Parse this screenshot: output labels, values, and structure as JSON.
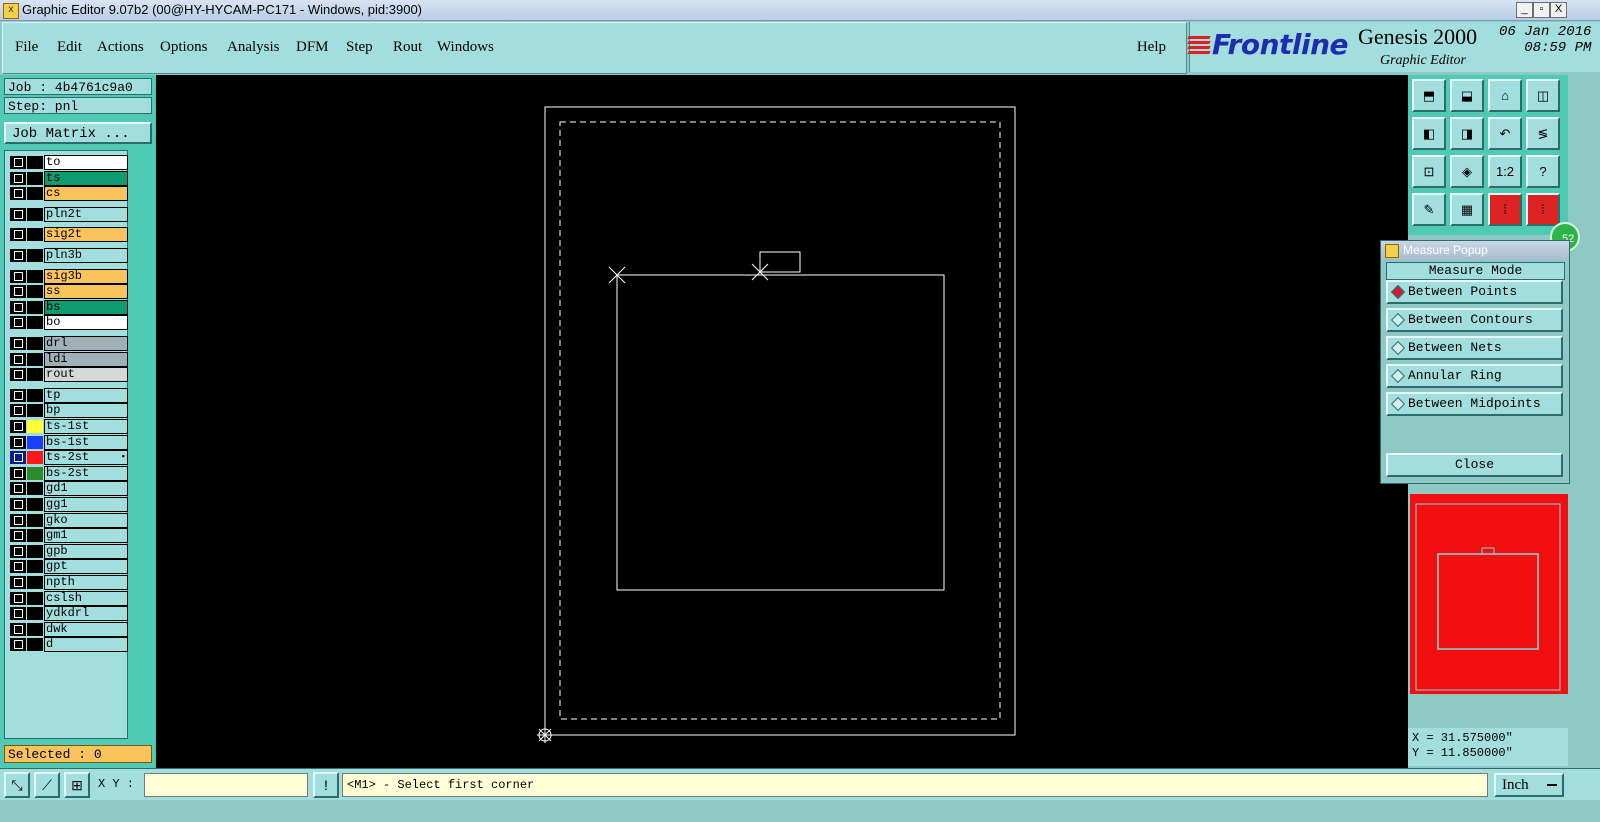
{
  "window": {
    "title": "Graphic Editor 9.07b2 (00@HY-HYCAM-PC171 - Windows, pid:3900)",
    "controls": [
      "_",
      "▫",
      "X"
    ]
  },
  "menu": {
    "items": [
      "File",
      "Edit",
      "Actions",
      "Options",
      "Analysis",
      "DFM",
      "Step",
      "Rout",
      "Windows"
    ],
    "help": "Help"
  },
  "brand": {
    "logo": "Frontline",
    "product": "Genesis 2000",
    "subtitle": "Graphic Editor",
    "date": "06 Jan 2016",
    "time": "08:59 PM"
  },
  "job": {
    "job_label": "Job : 4b4761c9a0",
    "step_label": "Step: pnl",
    "matrix_button": "Job Matrix ..."
  },
  "layers": [
    {
      "name": "to",
      "bg": "#ffffff",
      "swatch": "#000000"
    },
    {
      "name": "ts",
      "bg": "#0e9c6e",
      "swatch": "#000000"
    },
    {
      "name": "cs",
      "bg": "#fbc35b",
      "swatch": "#000000"
    },
    {
      "name": "pln2t",
      "bg": "#a2dedd",
      "swatch": "#000000"
    },
    {
      "name": "sig2t",
      "bg": "#fbc35b",
      "swatch": "#000000"
    },
    {
      "name": "pln3b",
      "bg": "#a2dedd",
      "swatch": "#000000"
    },
    {
      "name": "sig3b",
      "bg": "#fbc35b",
      "swatch": "#000000"
    },
    {
      "name": "ss",
      "bg": "#fbc35b",
      "swatch": "#000000"
    },
    {
      "name": "bs",
      "bg": "#0e9c6e",
      "swatch": "#000000"
    },
    {
      "name": "bo",
      "bg": "#ffffff",
      "swatch": "#000000"
    },
    {
      "name": "drl",
      "bg": "#9fb0b6",
      "swatch": "#000000"
    },
    {
      "name": "ldi",
      "bg": "#9fb0b6",
      "swatch": "#000000"
    },
    {
      "name": "rout",
      "bg": "#d4d8d8",
      "swatch": "#000000"
    },
    {
      "name": "tp",
      "bg": "#a2dedd",
      "swatch": "#000000"
    },
    {
      "name": "bp",
      "bg": "#a2dedd",
      "swatch": "#000000"
    },
    {
      "name": "ts-1st",
      "bg": "#a2dedd",
      "swatch": "#ffff33"
    },
    {
      "name": "bs-1st",
      "bg": "#a2dedd",
      "swatch": "#1a3cff"
    },
    {
      "name": "ts-2st",
      "bg": "#a2dedd",
      "swatch": "#ff1a1a",
      "active": true,
      "mark": "▪"
    },
    {
      "name": "bs-2st",
      "bg": "#a2dedd",
      "swatch": "#2c8a2c"
    },
    {
      "name": "gd1",
      "bg": "#a2dedd",
      "swatch": "#000000"
    },
    {
      "name": "gg1",
      "bg": "#a2dedd",
      "swatch": "#000000"
    },
    {
      "name": "gko",
      "bg": "#a2dedd",
      "swatch": "#000000"
    },
    {
      "name": "gm1",
      "bg": "#a2dedd",
      "swatch": "#000000"
    },
    {
      "name": "gpb",
      "bg": "#a2dedd",
      "swatch": "#000000"
    },
    {
      "name": "gpt",
      "bg": "#a2dedd",
      "swatch": "#000000"
    },
    {
      "name": "npth",
      "bg": "#a2dedd",
      "swatch": "#000000"
    },
    {
      "name": "cslsh",
      "bg": "#a2dedd",
      "swatch": "#000000"
    },
    {
      "name": "ydkdrl",
      "bg": "#a2dedd",
      "swatch": "#000000"
    },
    {
      "name": "dwk",
      "bg": "#a2dedd",
      "swatch": "#000000"
    },
    {
      "name": "d",
      "bg": "#a2dedd",
      "swatch": "#000000"
    }
  ],
  "selected_label": "Selected : 0",
  "toolbox": {
    "buttons": [
      "top-view",
      "bottom-view",
      "home",
      "split-view",
      "left",
      "right",
      "undo-zoom",
      "snake",
      "fit",
      "fit-center",
      "1:2",
      "?",
      "pen-settings",
      "grid",
      "layers-red-1",
      "layers-red-2"
    ],
    "text_buttons": {
      "ratio": "1:2",
      "help": "?"
    },
    "badge": "52"
  },
  "measure_popup": {
    "title": "Measure Popup",
    "mode_title": "Measure Mode",
    "options": [
      "Between Points",
      "Between Contours",
      "Between Nets",
      "Annular Ring",
      "Between Midpoints"
    ],
    "selected_index": 0,
    "close": "Close"
  },
  "coords": {
    "x": "X = 31.575000\"",
    "y": "Y = 11.850000\""
  },
  "bottom": {
    "xy_label": "X Y :",
    "xy_value": "",
    "exclaim": "!",
    "prompt": "<M1> - Select first corner",
    "unit": "Inch"
  },
  "colors": {
    "canvas": "#000000",
    "panel": "#a2dedd",
    "minimap": "#f20f0f",
    "measure_accent": "#d11b3c"
  }
}
